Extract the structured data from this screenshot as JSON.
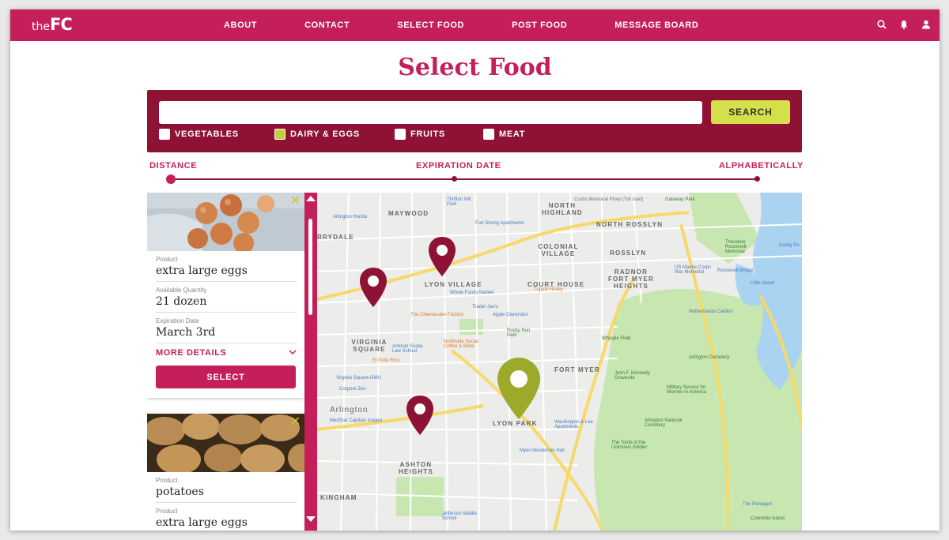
{
  "app": {
    "logo_prefix": "the",
    "logo_main": "FC"
  },
  "nav": {
    "links": [
      "ABOUT",
      "CONTACT",
      "SELECT FOOD",
      "POST FOOD",
      "MESSAGE BOARD"
    ],
    "icons": [
      "search-icon",
      "bell-icon",
      "user-icon"
    ]
  },
  "page": {
    "title": "Select Food"
  },
  "search": {
    "value": "",
    "button_label": "SEARCH",
    "filters": [
      {
        "label": "VEGETABLES",
        "checked": false
      },
      {
        "label": "DAIRY & EGGS",
        "checked": true
      },
      {
        "label": "FRUITS",
        "checked": false
      },
      {
        "label": "MEAT",
        "checked": false
      }
    ]
  },
  "sort": {
    "options": [
      "DISTANCE",
      "EXPIRATION DATE",
      "ALPHABETICALLY"
    ],
    "selected": "DISTANCE"
  },
  "listings": [
    {
      "product_label": "Product",
      "product": "extra large eggs",
      "qty_label": "Available Quantity",
      "qty": "21 dozen",
      "exp_label": "Expiration Date",
      "exp": "March 3rd",
      "more_label": "MORE DETAILS",
      "select_label": "SELECT"
    },
    {
      "product_label": "Product",
      "product": "potatoes",
      "product2_label": "Product",
      "product2": "extra large eggs"
    }
  ],
  "map": {
    "neighborhoods": [
      "MAYWOOD",
      "NORTH HIGHLAND",
      "NORTH ROSSLYN",
      "COLONIAL VILLAGE",
      "ROSSLYN",
      "LYON VILLAGE",
      "COURT HOUSE",
      "RADNOR FORT MYER HEIGHTS",
      "VIRGINIA SQUARE",
      "FORT MYER",
      "Arlington",
      "LYON PARK",
      "ASHTON HEIGHTS",
      "KINGHAM",
      "RRYDALE"
    ],
    "places": [
      "Thrifton Hill Park",
      "Fort Strong Apartments",
      "Custis Memorial Pkwy (Toll road)",
      "Gateway Park",
      "Arlington Honda",
      "Whole Foods Market",
      "The Cheesecake Factory",
      "Trader Joe's",
      "Apple Clarendon",
      "Tupelo Honey",
      "Northside Social Coffee & Wine",
      "Antonio Scalia Law School",
      "El Pollo Rico",
      "Virginia Square-GMU",
      "Corpore Zen",
      "MedStar Capitals Iceplex",
      "Nethenlands Carillon",
      "Whipple Field",
      "Arlington Cemetery",
      "John F. Kennedy Gravesite",
      "Military Service for Women in America",
      "Arlington National Cemetery",
      "The Tomb of the Unknown Soldier",
      "US Marine Corps War Memorial",
      "Little Island",
      "Roosevelt Bridge",
      "Theodore Roosevelt Memorial",
      "The Pentagon",
      "Columbia Island",
      "Myer-Henderson Hall",
      "Jefferson Middle School",
      "Washington & Lee Apartments",
      "Rocky Run Park",
      "Hayes Park",
      "Easby Po"
    ],
    "pins": [
      {
        "color": "#8e1234",
        "label": "listing-pin"
      },
      {
        "color": "#8e1234",
        "label": "listing-pin"
      },
      {
        "color": "#8e1234",
        "label": "listing-pin"
      },
      {
        "color": "#9ca92a",
        "label": "selected-pin"
      }
    ]
  },
  "colors": {
    "brand": "#c41f5a",
    "dark": "#8e1234",
    "accent": "#d4df4a",
    "water": "#aad3f2",
    "park": "#c8e6b0"
  }
}
